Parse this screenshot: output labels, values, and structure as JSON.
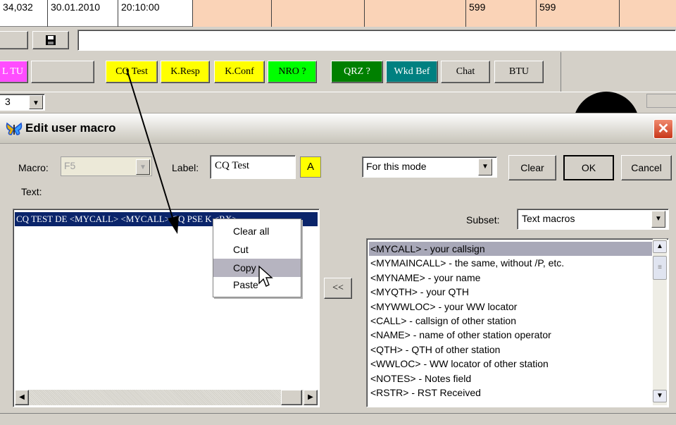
{
  "log_row": {
    "freq": "34,032",
    "date": "30.01.2010",
    "time": "20:10:00",
    "val1": "599",
    "val2": "599"
  },
  "toolbar": {
    "save_icon": "floppy-icon"
  },
  "macro_buttons": [
    {
      "label": "L TU",
      "bg": "#ff4dff"
    },
    {
      "label": "",
      "bg": "#d4d0c8"
    },
    {
      "label": "CQ Test",
      "bg": "#ffff00"
    },
    {
      "label": "K.Resp",
      "bg": "#ffff00"
    },
    {
      "label": "K.Conf",
      "bg": "#ffff00"
    },
    {
      "label": "NRO ?",
      "bg": "#00ff00"
    },
    {
      "label": "QRZ ?",
      "bg": "#008000"
    },
    {
      "label": "Wkd Bef",
      "bg": "#008080"
    },
    {
      "label": "Chat",
      "bg": "#d4d0c8"
    },
    {
      "label": "BTU",
      "bg": "#d4d0c8"
    }
  ],
  "band_combo_value": "3",
  "dialog": {
    "title": "Edit user macro",
    "macro_label": "Macro:",
    "macro_value": "F5",
    "label_label": "Label:",
    "label_value": "CQ Test",
    "color_button": "A",
    "text_label": "Text:",
    "text_value": "CQ TEST DE <MYCALL> <MYCALL> CQ PSE K <RX>",
    "mode_select": "For this mode",
    "clear_button": "Clear",
    "ok_button": "OK",
    "cancel_button": "Cancel",
    "subset_label": "Subset:",
    "subset_value": "Text macros",
    "insert_button": "<<",
    "macro_list": [
      "<MYCALL> - your callsign",
      "<MYMAINCALL> - the same, without /P, etc.",
      "<MYNAME> - your name",
      "<MYQTH> - your QTH",
      "<MYWWLOC> - your WW locator",
      "<CALL> - callsign of other station",
      "<NAME> - name of other station operator",
      "<QTH> - QTH of other station",
      "<WWLOC> - WW locator of other station",
      "<NOTES> - Notes field",
      "<RSTR> - RST Received"
    ],
    "context_menu": [
      "Clear all",
      "Cut",
      "Copy",
      "Paste"
    ]
  },
  "colors": {
    "selection": "#0a246a",
    "titlebar_close": "#d9441f",
    "list_selected": "#a8a8b8"
  }
}
